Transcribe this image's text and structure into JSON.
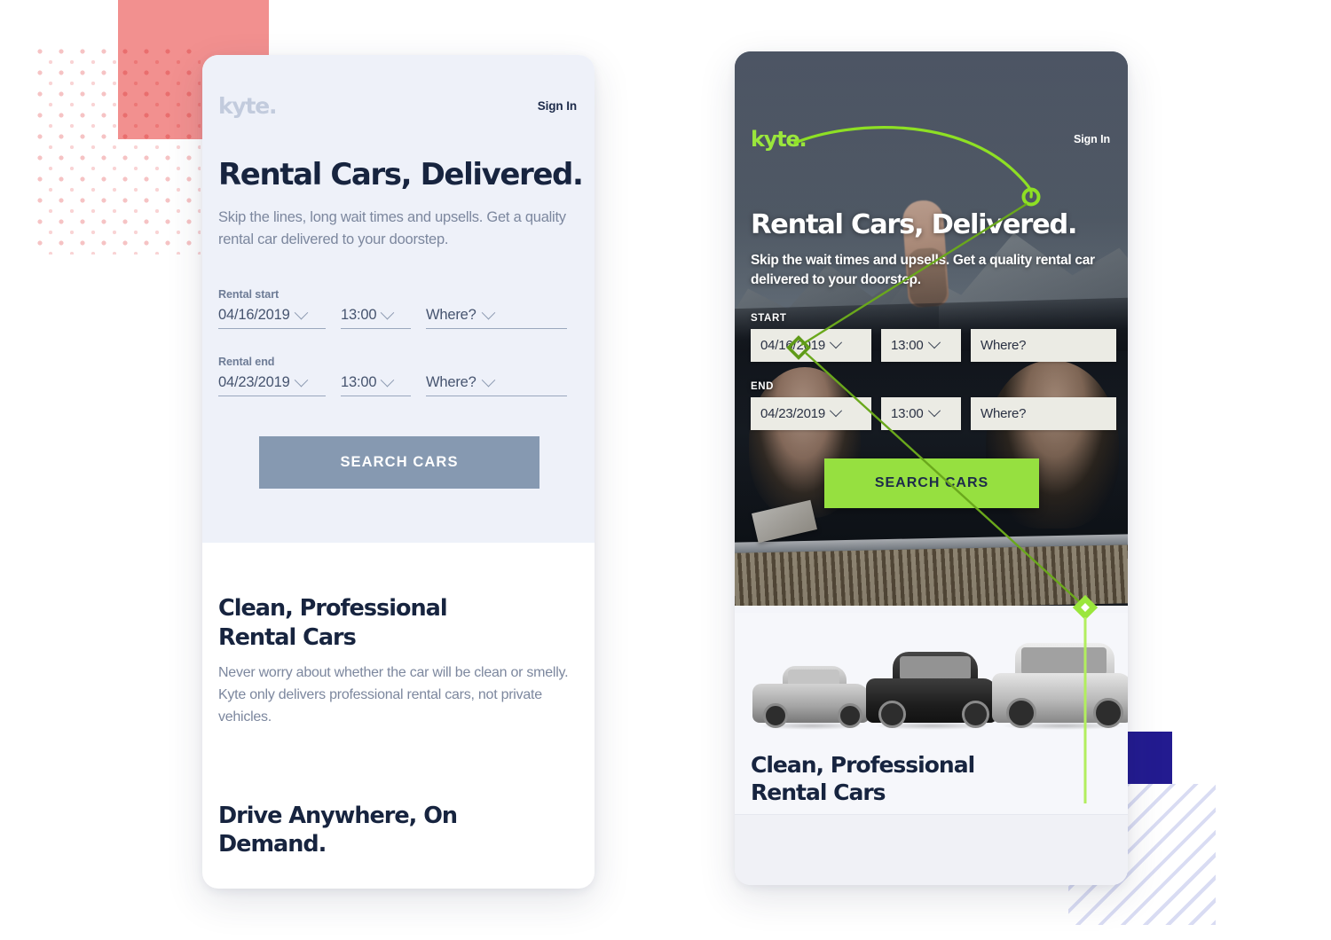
{
  "brand": {
    "name": "kyte.",
    "accent_green": "#96e040",
    "navy": "#17243f",
    "slate_button": "#8699b1",
    "pink_square": "#f2908f",
    "blue_square": "#231b90",
    "dot_pattern": "#f6c3c4",
    "stripe_pattern": "#d9dcf3"
  },
  "left_card": {
    "logo": "kyte.",
    "sign_in": "Sign In",
    "headline": "Rental Cars, Delivered.",
    "subhead": "Skip the lines, long wait times and upsells. Get a quality rental car delivered to your doorstep.",
    "start": {
      "label": "Rental start",
      "date": "04/16/2019",
      "time": "13:00",
      "where_placeholder": "Where?"
    },
    "end": {
      "label": "Rental end",
      "date": "04/23/2019",
      "time": "13:00",
      "where_placeholder": "Where?"
    },
    "search_button": "SEARCH CARS",
    "section_one": {
      "heading": "Clean, Professional Rental Cars",
      "body": "Never worry about whether the car will be clean or smelly. Kyte only delivers professional rental cars, not private vehicles."
    },
    "section_two": {
      "heading": "Drive Anywhere, On Demand."
    }
  },
  "right_card": {
    "logo": "kyte.",
    "sign_in": "Sign In",
    "headline": "Rental Cars, Delivered.",
    "subhead": "Skip the wait times and upsells. Get a quality rental car delivered to your doorstep.",
    "start": {
      "label": "START",
      "date": "04/16/2019",
      "time": "13:00",
      "where_placeholder": "Where?"
    },
    "end": {
      "label": "END",
      "date": "04/23/2019",
      "time": "13:00",
      "where_placeholder": "Where?"
    },
    "search_button": "SEARCH CARS",
    "section_one": {
      "heading": "Clean, Professional Rental Cars"
    }
  },
  "icons": {
    "chevron_down": "chevron-down-icon",
    "circle_marker": "circle-marker-icon",
    "diamond_marker": "diamond-marker-icon"
  }
}
